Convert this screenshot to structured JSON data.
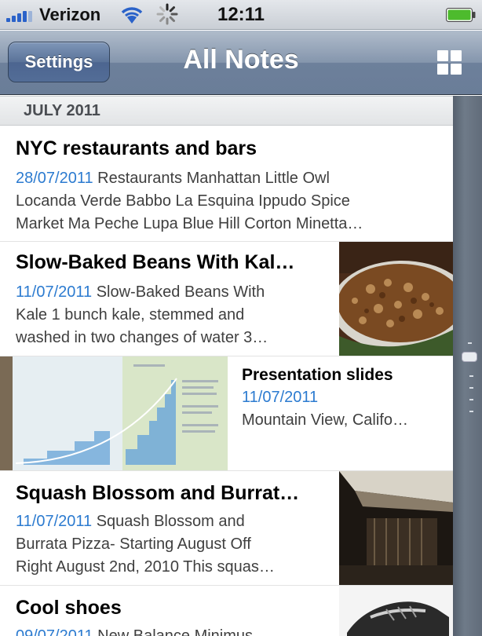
{
  "status_bar": {
    "carrier": "Verizon",
    "time": "12:11"
  },
  "nav": {
    "settings_label": "Settings",
    "title": "All Notes"
  },
  "section": {
    "header": "JULY 2011"
  },
  "notes": [
    {
      "title": "NYC restaurants and bars",
      "date": "28/07/2011",
      "line1_rest": " Restaurants Manhattan Little Owl",
      "line2": "Locanda Verde Babbo La Esquina Ippudo Spice",
      "line3": "Market Ma Peche Lupa Blue Hill Corton Minetta…"
    },
    {
      "title": "Slow-Baked Beans With Kal…",
      "date": "11/07/2011",
      "line1_rest": " Slow-Baked Beans With",
      "line2": "Kale 1 bunch kale, stemmed and",
      "line3": "washed in two changes of water 3…"
    },
    {
      "title": "Presentation slides",
      "date": "11/07/2011",
      "line2": "Mountain View, Califo…"
    },
    {
      "title": "Squash Blossom and Burrat…",
      "date": "11/07/2011",
      "line1_rest": " Squash Blossom and",
      "line2": "Burrata Pizza- Starting August Off",
      "line3": "Right August 2nd, 2010 This squas…"
    },
    {
      "title": "Cool shoes",
      "date": "09/07/2011",
      "line1_rest": " New Balance Minimus"
    }
  ],
  "colors": {
    "date_blue": "#2c7bd0",
    "nav_bar": "#7b8ea7"
  },
  "icons": {
    "grid": "grid-view-icon",
    "wifi": "wifi-icon",
    "activity": "activity-spinner-icon",
    "battery": "battery-icon",
    "signal": "signal-bars-icon"
  }
}
